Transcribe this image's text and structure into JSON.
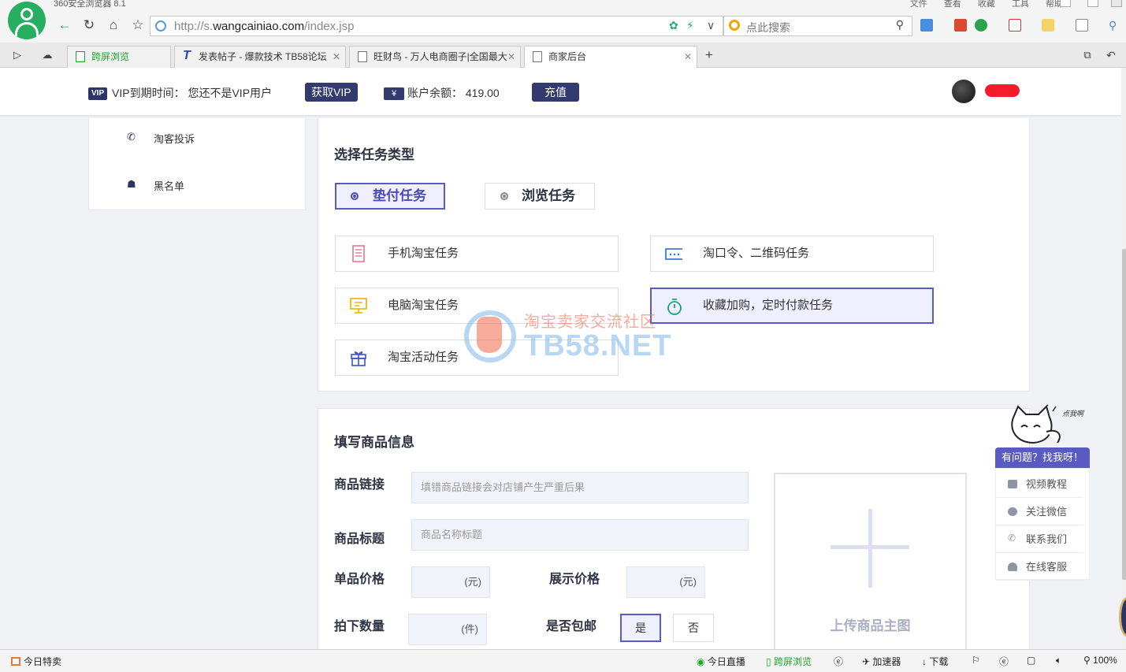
{
  "browser": {
    "title": "360安全浏览器 8.1",
    "menu": [
      "文件",
      "查看",
      "收藏",
      "工具",
      "帮助"
    ],
    "url_prefix": "http://s.",
    "url_domain": "wangcainiao.com",
    "url_path": "/index.jsp",
    "search_placeholder": "点此搜索",
    "tabs": [
      {
        "label": "跨屏浏览"
      },
      {
        "label": "发表帖子 - 爆款技术 TB58论坛"
      },
      {
        "label": "旺财鸟 - 万人电商圈子|全国最大"
      },
      {
        "label": "商家后台"
      }
    ]
  },
  "header": {
    "vip_badge": "VIP",
    "vip_expiry_label": "VIP到期时间：",
    "vip_expiry_value": "您还不是VIP用户",
    "get_vip_button": "获取VIP",
    "yen_badge": "¥",
    "balance_label": "账户余额：",
    "balance_value": "419.00",
    "recharge_button": "充值"
  },
  "sidebar": {
    "items": [
      {
        "label": "淘客投诉",
        "icon": "phone-icon"
      },
      {
        "label": "黑名单",
        "icon": "user-block-icon"
      }
    ]
  },
  "task_type": {
    "title": "选择任务类型",
    "types": [
      {
        "label": "垫付任务",
        "selected": true
      },
      {
        "label": "浏览任务",
        "selected": false
      }
    ],
    "tasks": [
      {
        "label": "手机淘宝任务",
        "icon": "mobile-icon",
        "color": "#e8748f"
      },
      {
        "label": "淘口令、二维码任务",
        "icon": "qr-code-icon",
        "color": "#2f6ad1"
      },
      {
        "label": "电脑淘宝任务",
        "icon": "desktop-icon",
        "color": "#e5b400"
      },
      {
        "label": "收藏加购，定时付款任务",
        "icon": "timer-icon",
        "color": "#1ea07a",
        "selected": true
      },
      {
        "label": "淘宝活动任务",
        "icon": "gift-icon",
        "color": "#3a55c9"
      }
    ]
  },
  "product_info": {
    "title": "填写商品信息",
    "link_label": "商品链接",
    "link_placeholder": "填错商品链接会对店铺产生严重后果",
    "title_label": "商品标题",
    "title_placeholder": "商品名称标题",
    "unit_price_label": "单品价格",
    "unit_price_unit": "(元)",
    "display_price_label": "展示价格",
    "display_price_unit": "(元)",
    "quantity_label": "拍下数量",
    "quantity_unit": "(件)",
    "free_shipping_label": "是否包邮",
    "yes": "是",
    "no": "否",
    "upload_label": "上传商品主图"
  },
  "watermark": {
    "cn": "淘宝卖家交流社区",
    "en": "TB58.NET"
  },
  "help_widget": {
    "cat_caption": "点我啊",
    "title": "有问题？找我呀！",
    "items": [
      {
        "label": "视频教程",
        "icon": "video-icon"
      },
      {
        "label": "关注微信",
        "icon": "wechat-icon"
      },
      {
        "label": "联系我们",
        "icon": "phone-icon"
      },
      {
        "label": "在线客服",
        "icon": "support-icon"
      }
    ]
  },
  "statusbar": {
    "left": "今日特卖",
    "live": "今日直播",
    "cross_screen": "跨屏浏览",
    "accelerator": "加速器",
    "download": "下载",
    "zoom": "100%"
  }
}
